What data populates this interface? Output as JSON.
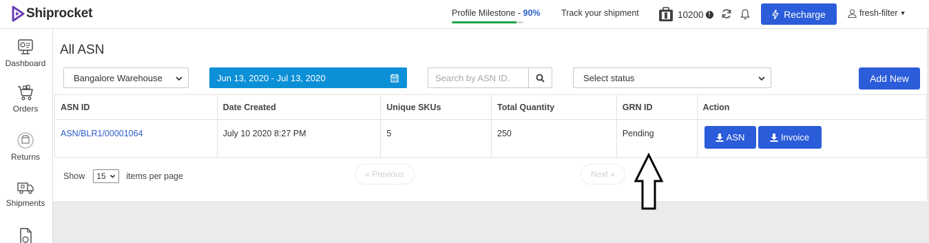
{
  "header": {
    "brand": "Shiprocket",
    "milestone_label": "Profile Milestone - ",
    "milestone_percent": "90%",
    "milestone_progress": 0.9,
    "track_label": "Track your shipment",
    "wallet_amount": "10200",
    "recharge_label": "Recharge",
    "user_name": "fresh-filter"
  },
  "sidebar": {
    "items": [
      {
        "label": "Dashboard",
        "icon": "dashboard-icon"
      },
      {
        "label": "Orders",
        "icon": "cart-icon"
      },
      {
        "label": "Returns",
        "icon": "returns-icon"
      },
      {
        "label": "Shipments",
        "icon": "truck-icon"
      },
      {
        "label": "",
        "icon": "document-icon"
      }
    ]
  },
  "page": {
    "title": "All ASN",
    "warehouse": "Bangalore Warehouse",
    "date_range": "Jun 13, 2020 - Jul 13, 2020",
    "search_placeholder": "Search by ASN ID.",
    "status_select": "Select status",
    "add_new": "Add New"
  },
  "table": {
    "headers": [
      "ASN ID",
      "Date Created",
      "Unique SKUs",
      "Total Quantity",
      "GRN ID",
      "Action"
    ],
    "rows": [
      {
        "asn_id": "ASN/BLR1/00001064",
        "date_created": "July 10 2020 8:27 PM",
        "unique_skus": "5",
        "total_quantity": "250",
        "grn_id": "Pending",
        "asn_button": "ASN",
        "invoice_button": "Invoice"
      }
    ]
  },
  "pagination": {
    "show_label": "Show",
    "page_size": "15",
    "items_label": "items per page",
    "previous": "« Previous",
    "next": "Next »"
  },
  "colors": {
    "primary": "#2b5cd9",
    "date_button": "#0b8fd6",
    "milestone_fill": "#1aa845",
    "link": "#2b5cc9"
  }
}
